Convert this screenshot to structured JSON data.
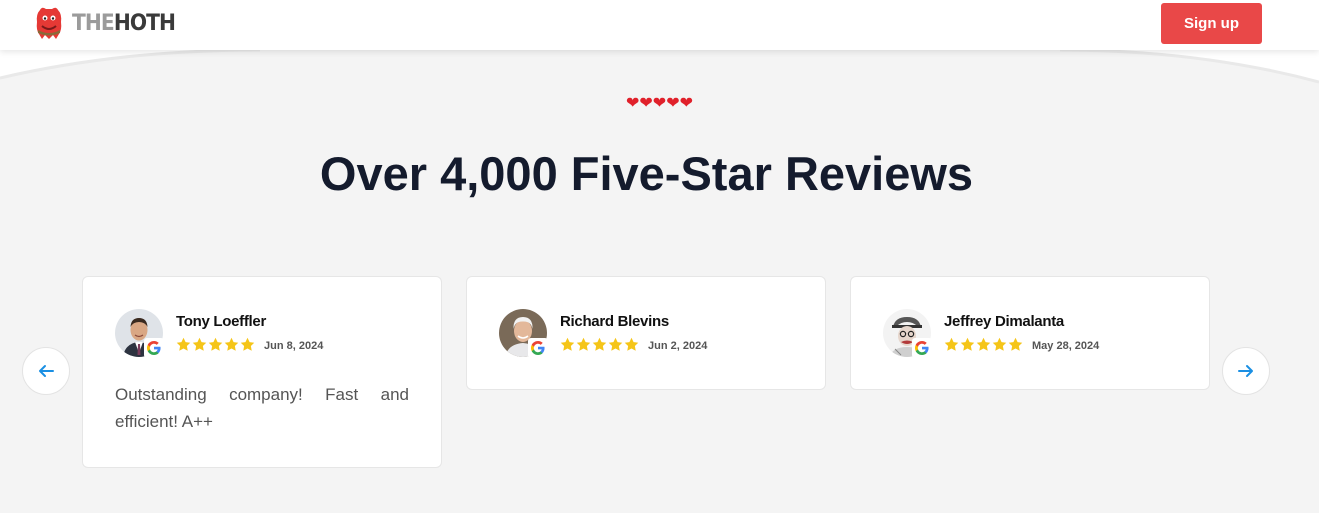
{
  "header": {
    "logo": {
      "the": "THE",
      "hoth": "HOTH"
    },
    "signup_label": "Sign up"
  },
  "colors": {
    "accent": "#e94848",
    "heading": "#141b2d",
    "star": "#f5c518",
    "heart": "#e0202a",
    "arrow": "#1a8fe3"
  },
  "hearts": [
    "❤",
    "❤",
    "❤",
    "❤",
    "❤"
  ],
  "section": {
    "title": "Over 4,000 Five-Star Reviews"
  },
  "reviews": [
    {
      "name": "Tony Loeffler",
      "date": "Jun 8, 2024",
      "rating": 5,
      "text": "Outstanding company! Fast and efficient! A++",
      "source": "google-icon"
    },
    {
      "name": "Richard Blevins",
      "date": "Jun 2, 2024",
      "rating": 5,
      "text": "",
      "source": "google-icon"
    },
    {
      "name": "Jeffrey Dimalanta",
      "date": "May 28, 2024",
      "rating": 5,
      "text": "",
      "source": "google-icon"
    }
  ],
  "carousel": {
    "prev_icon": "arrow-left-icon",
    "next_icon": "arrow-right-icon"
  }
}
